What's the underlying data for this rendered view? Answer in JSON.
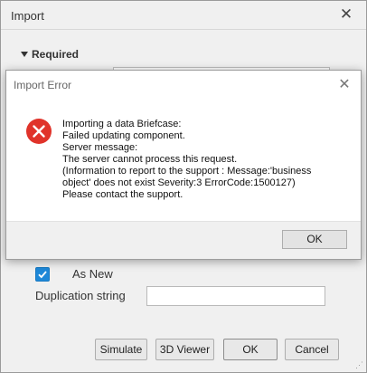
{
  "import_window": {
    "title": "Import",
    "close_glyph": "✕",
    "section_required": "Required",
    "as_new_label": "As New",
    "as_new_checked": true,
    "duplication_label": "Duplication string",
    "duplication_value": "",
    "buttons": {
      "simulate": "Simulate",
      "viewer_3d": "3D Viewer",
      "ok": "OK",
      "cancel": "Cancel"
    }
  },
  "error_dialog": {
    "title": "Import Error",
    "close_glyph": "✕",
    "icon": "error-icon",
    "message_lines": [
      "Importing a data Briefcase:",
      "Failed updating component.",
      "Server message:",
      "The server cannot process this request.",
      "(Information to report to the support : Message:'business",
      "object' does not exist Severity:3 ErrorCode:1500127)",
      "Please contact the support."
    ],
    "ok_label": "OK"
  },
  "colors": {
    "error_red": "#e0332a",
    "checkbox_blue": "#1e88d8"
  }
}
